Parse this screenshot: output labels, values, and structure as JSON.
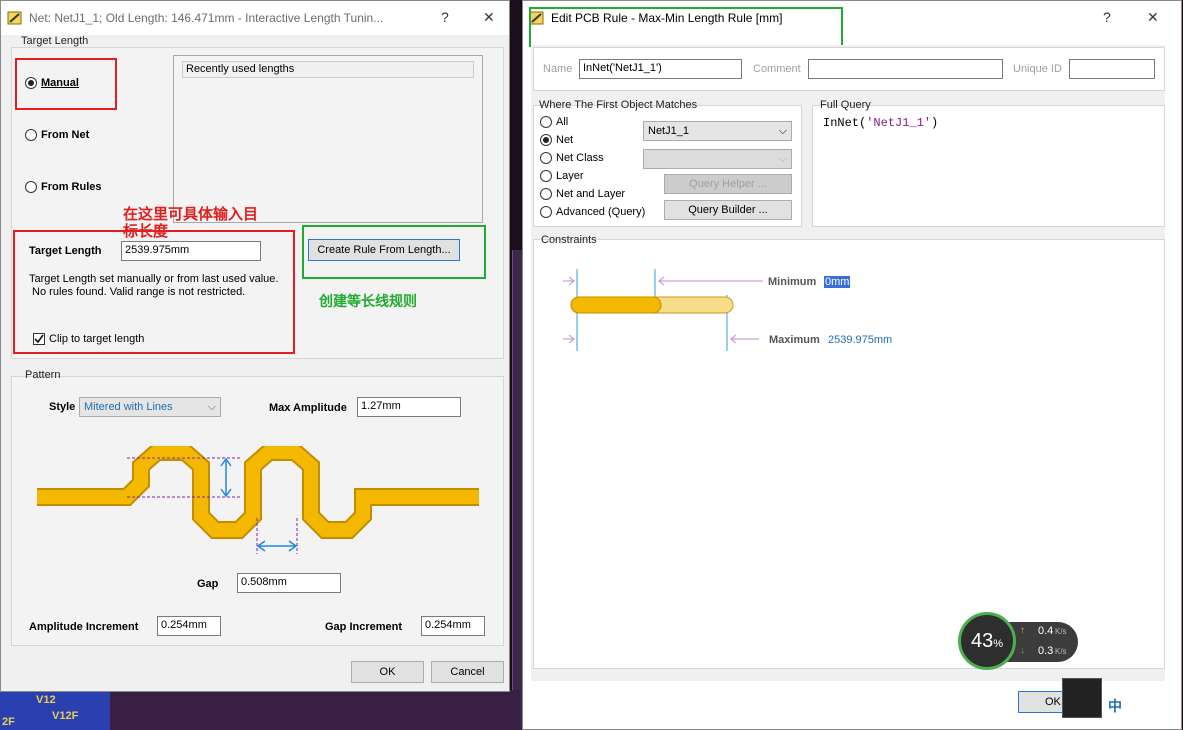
{
  "left_dialog": {
    "title": "Net: NetJ1_1;  Old Length: 146.471mm -  Interactive Length Tunin...",
    "help": "?",
    "close": "✕",
    "target_length_group": "Target Length",
    "manual": "Manual",
    "from_net": "From Net",
    "from_rules": "From Rules",
    "recent_header": "Recently used lengths",
    "target_length_label": "Target Length",
    "target_length_value": "2539.975mm",
    "info_line1": "Target Length set manually or from last used value.",
    "info_line2": " No rules found. Valid range is not restricted.",
    "create_rule_btn": "Create Rule From Length...",
    "clip_label": "Clip to target length",
    "pattern_group": "Pattern",
    "style_label": "Style",
    "style_value": "Mitered with Lines",
    "max_amp_label": "Max Amplitude",
    "max_amp_value": "1.27mm",
    "gap_label": "Gap",
    "gap_value": "0.508mm",
    "amp_inc_label": "Amplitude Increment",
    "amp_inc_value": "0.254mm",
    "gap_inc_label": "Gap Increment",
    "gap_inc_value": "0.254mm",
    "ok": "OK",
    "cancel": "Cancel"
  },
  "annotations": {
    "red_note_line1": "在这里可具体输入目",
    "red_note_line2": "标长度",
    "green_note": "创建等长线规则"
  },
  "right_dialog": {
    "title": "Edit PCB Rule - Max-Min Length Rule [mm]",
    "help": "?",
    "close": "✕",
    "name_label": "Name",
    "name_value": "InNet('NetJ1_1')",
    "comment_label": "Comment",
    "comment_value": "",
    "uniqueid_label": "Unique ID",
    "uniqueid_value": "",
    "where_group": "Where The First Object Matches",
    "opt_all": "All",
    "opt_net": "Net",
    "opt_netclass": "Net Class",
    "opt_layer": "Layer",
    "opt_netlayer": "Net and Layer",
    "opt_advanced": "Advanced (Query)",
    "net_select": "NetJ1_1",
    "query_helper": "Query Helper ...",
    "query_builder": "Query Builder ...",
    "full_query_label": "Full Query",
    "full_query_prefix": "InNet(",
    "full_query_arg": "'NetJ1_1'",
    "full_query_suffix": ")",
    "constraints_label": "Constraints",
    "minimum_label": "Minimum",
    "minimum_value": "0mm",
    "maximum_label": "Maximum",
    "maximum_value": "2539.975mm",
    "ok": "OK"
  },
  "pcb": {
    "label_v12": "V12",
    "label_v12f": "V12F",
    "label_2f": "2F"
  },
  "net_widget": {
    "percent": "43",
    "percent_sign": "%",
    "up": "0.4",
    "up_unit": "K/s",
    "down": "0.3",
    "down_unit": "K/s"
  },
  "ime": {
    "lang": "中"
  },
  "colors": {
    "accent_blue": "#1f6fb2",
    "red_note": "#e02020",
    "green_note": "#22aa33",
    "trace_gold": "#f5b800"
  }
}
